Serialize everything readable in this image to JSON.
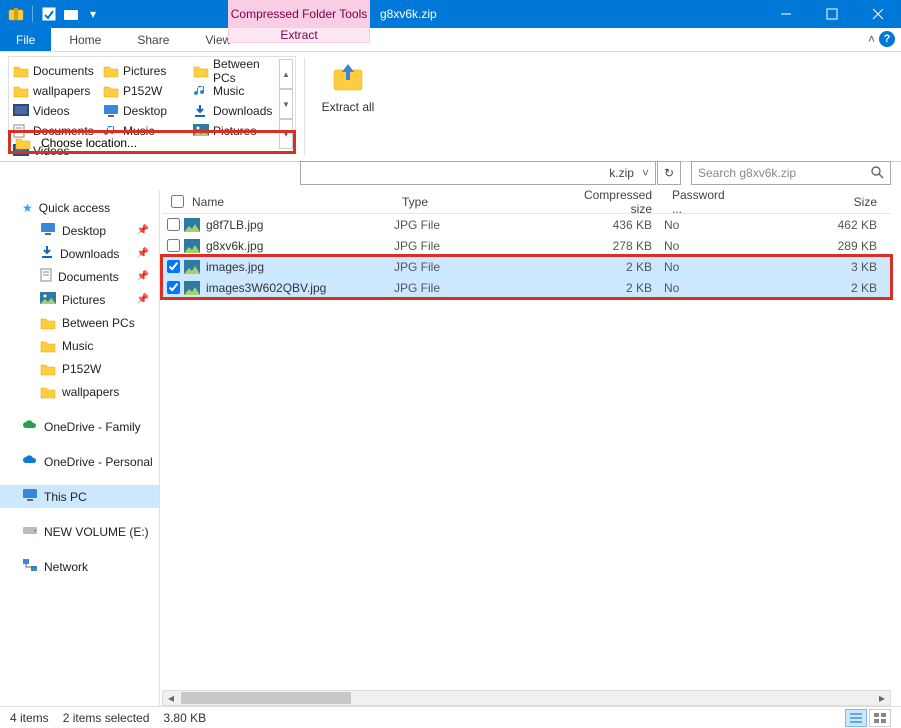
{
  "titlebar": {
    "context_tab": "Compressed Folder Tools",
    "title": "g8xv6k.zip"
  },
  "tabs": {
    "file": "File",
    "home": "Home",
    "share": "Share",
    "view": "View",
    "extract": "Extract"
  },
  "gallery": [
    {
      "label": "Documents",
      "icon": "folder"
    },
    {
      "label": "Pictures",
      "icon": "folder"
    },
    {
      "label": "Between PCs",
      "icon": "folder"
    },
    {
      "label": "wallpapers",
      "icon": "folder"
    },
    {
      "label": "P152W",
      "icon": "folder"
    },
    {
      "label": "Music",
      "icon": "music"
    },
    {
      "label": "Videos",
      "icon": "video"
    },
    {
      "label": "Desktop",
      "icon": "desktop"
    },
    {
      "label": "Downloads",
      "icon": "download"
    },
    {
      "label": "Documents",
      "icon": "doc"
    },
    {
      "label": "Music",
      "icon": "music"
    },
    {
      "label": "Pictures",
      "icon": "pic"
    },
    {
      "label": "Videos",
      "icon": "video"
    }
  ],
  "choose_location": "Choose location...",
  "extract_all": "Extract all",
  "address": {
    "tail": "k.zip"
  },
  "search": {
    "placeholder": "Search g8xv6k.zip"
  },
  "nav": {
    "quick_access": "Quick access",
    "items_pinned": [
      {
        "label": "Desktop",
        "icon": "desktop"
      },
      {
        "label": "Downloads",
        "icon": "download"
      },
      {
        "label": "Documents",
        "icon": "doc"
      },
      {
        "label": "Pictures",
        "icon": "pic"
      }
    ],
    "items_plain": [
      {
        "label": "Between PCs"
      },
      {
        "label": "Music"
      },
      {
        "label": "P152W"
      },
      {
        "label": "wallpapers"
      }
    ],
    "onedrive_fam": "OneDrive - Family",
    "onedrive_per": "OneDrive - Personal",
    "this_pc": "This PC",
    "new_vol": "NEW VOLUME (E:)",
    "network": "Network"
  },
  "columns": {
    "name": "Name",
    "type": "Type",
    "compressed": "Compressed size",
    "password": "Password ...",
    "size": "Size"
  },
  "rows": [
    {
      "name": "g8f7LB.jpg",
      "type": "JPG File",
      "compressed": "436 KB",
      "password": "No",
      "size": "462 KB",
      "selected": false
    },
    {
      "name": "g8xv6k.jpg",
      "type": "JPG File",
      "compressed": "278 KB",
      "password": "No",
      "size": "289 KB",
      "selected": false
    },
    {
      "name": "images.jpg",
      "type": "JPG File",
      "compressed": "2 KB",
      "password": "No",
      "size": "3 KB",
      "selected": true
    },
    {
      "name": "images3W602QBV.jpg",
      "type": "JPG File",
      "compressed": "2 KB",
      "password": "No",
      "size": "2 KB",
      "selected": true
    }
  ],
  "status": {
    "count": "4 items",
    "selected": "2 items selected",
    "size": "3.80 KB"
  }
}
